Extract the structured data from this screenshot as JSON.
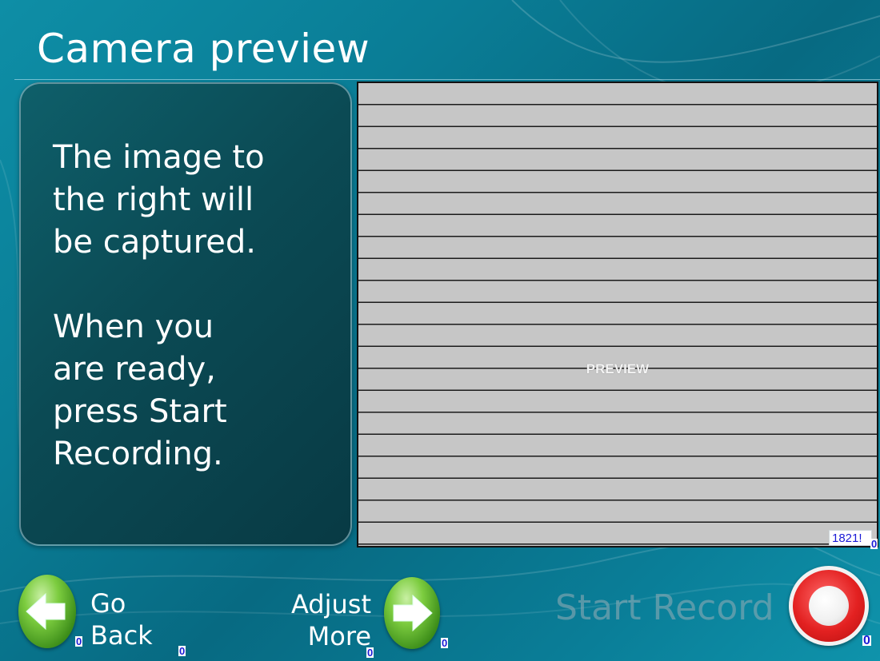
{
  "page": {
    "title": "Camera preview"
  },
  "info_panel": {
    "text": "The image to\nthe right will\nbe captured.\n\nWhen you\nare ready,\npress Start\nRecording."
  },
  "preview": {
    "label": "PREVIEW",
    "counter": "1821!"
  },
  "buttons": {
    "go_back": {
      "label": "Go\nBack",
      "icon": "arrow-left-icon",
      "counter": "0"
    },
    "go_back_label_counter": "0",
    "adjust_more": {
      "label": "Adjust\nMore",
      "icon": "arrow-right-icon",
      "counter": "0"
    },
    "adjust_more_icon_counter": "0",
    "start_recording": {
      "label": "Start Record",
      "icon": "record-icon",
      "counter": "0"
    }
  },
  "colors": {
    "background": "#0a7d96",
    "panel": "#0b4a54",
    "preview_fill": "#c6c6c6",
    "counter_text": "#1a1ad6",
    "go_button": "#7ccc3f",
    "record_button": "#e32121"
  }
}
